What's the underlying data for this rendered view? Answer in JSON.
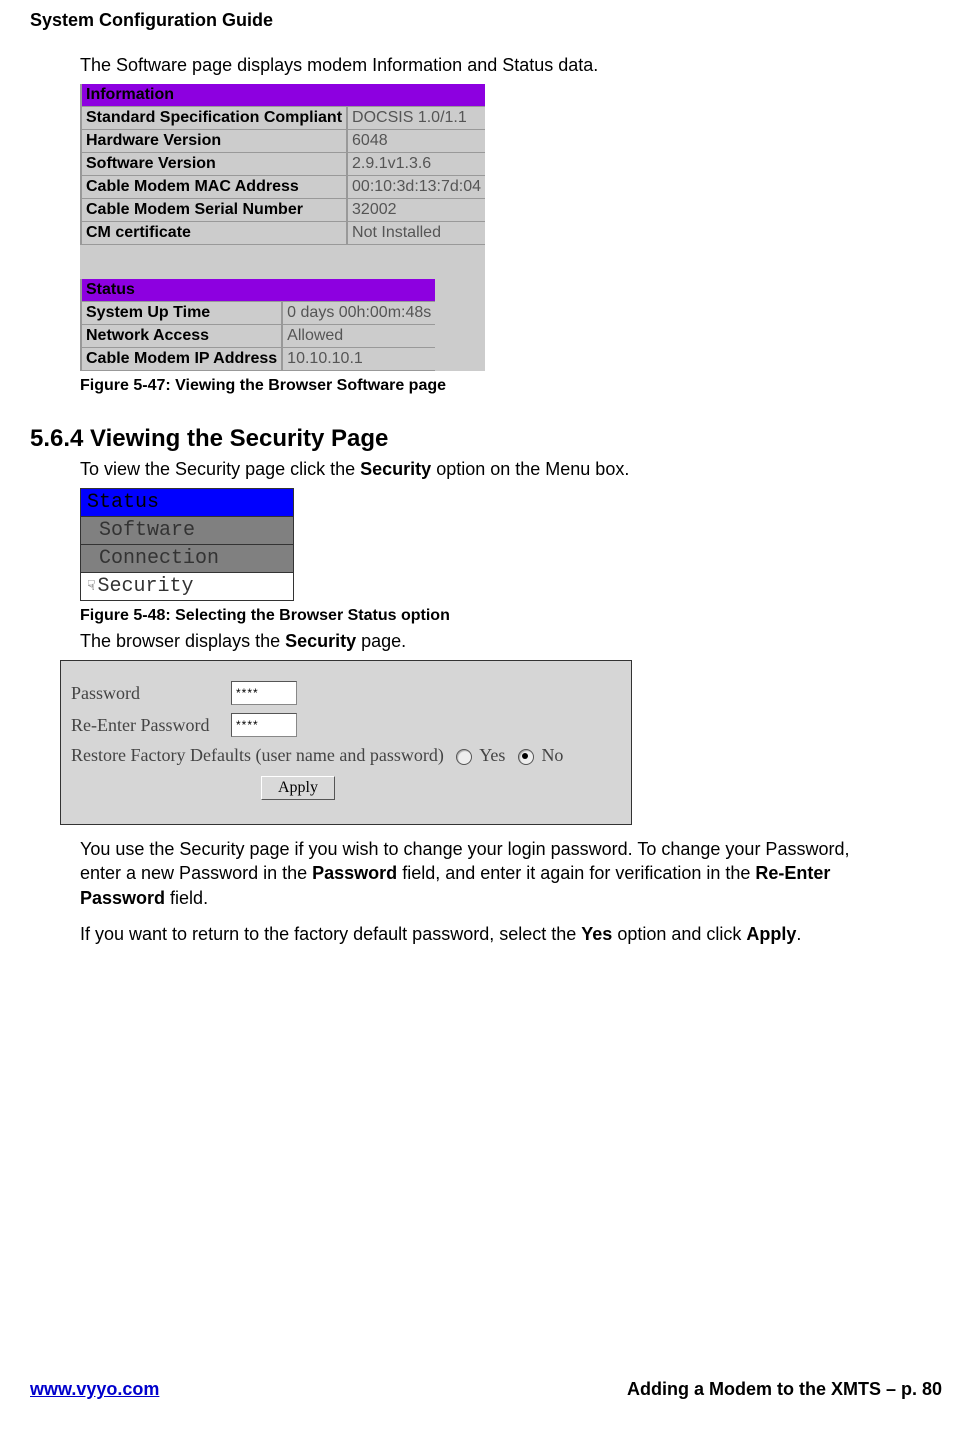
{
  "header": {
    "title": "System Configuration Guide"
  },
  "intro": {
    "text": "The Software page displays modem Information and Status data."
  },
  "info_table": {
    "section1_title": "Information",
    "rows1": [
      {
        "label": "Standard Specification Compliant",
        "value": "DOCSIS 1.0/1.1"
      },
      {
        "label": "Hardware Version",
        "value": "6048"
      },
      {
        "label": "Software Version",
        "value": "2.9.1v1.3.6"
      },
      {
        "label": "Cable Modem MAC Address",
        "value": "00:10:3d:13:7d:04"
      },
      {
        "label": "Cable Modem Serial Number",
        "value": "32002"
      },
      {
        "label": "CM certificate",
        "value": "Not Installed"
      }
    ],
    "section2_title": "Status",
    "rows2": [
      {
        "label": "System Up Time",
        "value": "0 days 00h:00m:48s"
      },
      {
        "label": "Network Access",
        "value": "Allowed"
      },
      {
        "label": "Cable Modem IP Address",
        "value": "10.10.10.1"
      }
    ]
  },
  "caption1": "Figure 5-47:  Viewing the Browser Software page",
  "section_heading": "5.6.4 Viewing the Security Page",
  "security_intro_pre": "To view the Security page click the ",
  "security_intro_bold": "Security",
  "security_intro_post": " option on the Menu box.",
  "menu": {
    "status": "Status",
    "software": "Software",
    "connection": "Connection",
    "security": "Security"
  },
  "caption2": "Figure 5-48:  Selecting the Browser Status option",
  "browser_displays_pre": "The browser displays the ",
  "browser_displays_bold": "Security",
  "browser_displays_post": " page.",
  "security_panel": {
    "password_label": "Password",
    "password_value": "****",
    "reenter_label": "Re-Enter Password",
    "reenter_value": "****",
    "restore_text": "Restore Factory Defaults (user name and password)",
    "yes": "Yes",
    "no": "No",
    "apply": "Apply"
  },
  "body1_pre": "You use the Security page if you wish to change your login password. To change your Password, enter a new Password in the ",
  "body1_b1": "Password",
  "body1_mid": " field, and enter it again for verification in the ",
  "body1_b2": "Re-Enter Password",
  "body1_post": " field.",
  "body2_pre": "If you want to return to the factory default password, select the ",
  "body2_b1": "Yes",
  "body2_mid": " option and click ",
  "body2_b2": "Apply",
  "body2_post": ".",
  "footer": {
    "left": "www.vyyo.com",
    "right": "Adding a Modem to the XMTS – p. 80"
  }
}
